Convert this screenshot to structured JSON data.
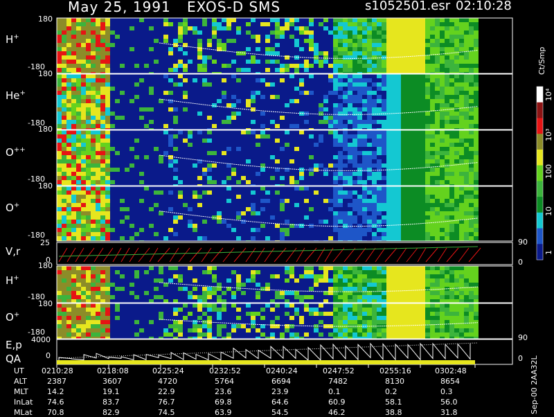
{
  "header": {
    "date": "May 25, 1991",
    "instrument": "EXOS-D SMS",
    "file": "s1052501.esr",
    "time": "02:10:28"
  },
  "panels": [
    {
      "id": "h1",
      "label": "H",
      "sup": "+",
      "ymax": "180",
      "ymin": "-180"
    },
    {
      "id": "he",
      "label": "He",
      "sup": "+",
      "ymax": "180",
      "ymin": "-180"
    },
    {
      "id": "opp",
      "label": "O",
      "sup": "++",
      "ymax": "180",
      "ymin": "-180"
    },
    {
      "id": "o1",
      "label": "O",
      "sup": "+",
      "ymax": "180",
      "ymin": "-180"
    },
    {
      "id": "vr",
      "label": "V,r",
      "sup": "",
      "ymax": "25",
      "ymin": "0",
      "rmax": "90",
      "rmin": "0"
    },
    {
      "id": "h2",
      "label": "H",
      "sup": "+",
      "ymax": "180",
      "ymin": "-180"
    },
    {
      "id": "o2",
      "label": "O",
      "sup": "+",
      "ymax": "180",
      "ymin": "-180"
    },
    {
      "id": "ep",
      "label": "E,p",
      "sup": "",
      "ymax": "4000",
      "ymin": "0",
      "rmax": "90",
      "rmin": "0"
    },
    {
      "id": "qa",
      "label": "QA",
      "sup": "",
      "ymax": "",
      "ymin": ""
    }
  ],
  "colorbar": {
    "unit": "Ct/Smp",
    "ticks": [
      "10⁴",
      "10³",
      "100",
      "10",
      "1"
    ]
  },
  "side_note": "Sep-00 2AA32L",
  "orbit_table": {
    "row_labels": [
      "UT",
      "ALT",
      "MLT",
      "InLat",
      "MLat"
    ],
    "columns": [
      {
        "UT": "0210:28",
        "ALT": "2387",
        "MLT": "14.2",
        "InLat": "74.6",
        "MLat": "70.8"
      },
      {
        "UT": "0218:08",
        "ALT": "3607",
        "MLT": "19.1",
        "InLat": "83.7",
        "MLat": "82.9"
      },
      {
        "UT": "0225:24",
        "ALT": "4720",
        "MLT": "22.9",
        "InLat": "76.7",
        "MLat": "74.5"
      },
      {
        "UT": "0232:52",
        "ALT": "5764",
        "MLT": "23.6",
        "InLat": "69.8",
        "MLat": "63.9"
      },
      {
        "UT": "0240:24",
        "ALT": "6694",
        "MLT": "23.9",
        "InLat": "64.6",
        "MLat": "54.5"
      },
      {
        "UT": "0247:52",
        "ALT": "7482",
        "MLT": "0.1",
        "InLat": "60.9",
        "MLat": "46.2"
      },
      {
        "UT": "0255:16",
        "ALT": "8130",
        "MLT": "0.2",
        "InLat": "58.1",
        "MLat": "38.8"
      },
      {
        "UT": "0302:48",
        "ALT": "8654",
        "MLT": "0.3",
        "InLat": "56.0",
        "MLat": "31.8"
      }
    ]
  },
  "chart_data": {
    "type": "heatmap",
    "title": "May 25, 1991  EXOS-D SMS",
    "x": [
      "0210:28",
      "0218:08",
      "0225:24",
      "0232:52",
      "0240:24",
      "0247:52",
      "0255:16",
      "0302:48"
    ],
    "xlabel": "UT",
    "series": [
      {
        "name": "H+",
        "ylim": [
          -180,
          180
        ]
      },
      {
        "name": "He+",
        "ylim": [
          -180,
          180
        ]
      },
      {
        "name": "O++",
        "ylim": [
          -180,
          180
        ]
      },
      {
        "name": "O+",
        "ylim": [
          -180,
          180
        ]
      },
      {
        "name": "V,r",
        "ylim": [
          0,
          25
        ],
        "y2lim": [
          0,
          90
        ]
      },
      {
        "name": "H+",
        "ylim": [
          -180,
          180
        ]
      },
      {
        "name": "O+",
        "ylim": [
          -180,
          180
        ]
      },
      {
        "name": "E,p",
        "ylim": [
          0,
          4000
        ],
        "y2lim": [
          0,
          90
        ]
      },
      {
        "name": "QA"
      }
    ],
    "colorbar": {
      "label": "Ct/Smp",
      "scale": "log",
      "ticks": [
        1,
        10,
        100,
        1000,
        10000
      ]
    },
    "colors": {
      "background": "#000000",
      "low": "#0a1a8a",
      "mid_blue": "#1e56c8",
      "cyan": "#14c8d2",
      "green_dark": "#0c8c24",
      "green": "#3cb43c",
      "green_light": "#64d21e",
      "yellow": "#e6e61e",
      "olive": "#8c8c28",
      "red": "#e61414",
      "white": "#ffffff"
    }
  }
}
